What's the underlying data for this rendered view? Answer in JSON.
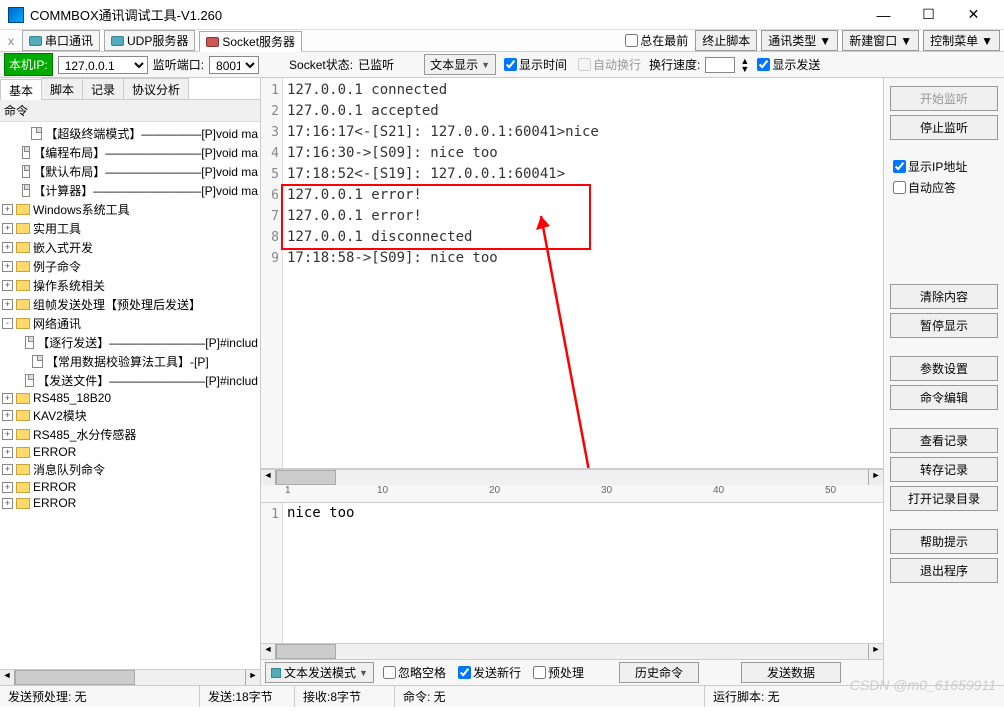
{
  "title": "COMMBOX通讯调试工具-V1.260",
  "topbar": {
    "tabs": [
      {
        "label": "串口通讯",
        "close": "x"
      },
      {
        "label": "UDP服务器",
        "close": "x"
      },
      {
        "label": "Socket服务器",
        "close": "x"
      }
    ],
    "always_top": "总在最前",
    "stop_script": "终止脚本",
    "comm_type": "通讯类型",
    "new_window": "新建窗口",
    "ctrl_menu": "控制菜单"
  },
  "toolbar": {
    "ip_label": "本机IP:",
    "ip_value": "127.0.0.1",
    "listen_port_label": "监听端口:",
    "port_value": "8001",
    "socket_status_label": "Socket状态:",
    "socket_status_value": "已监听",
    "text_display": "文本显示",
    "show_time": "显示时间",
    "auto_wrap": "自动换行",
    "wrap_speed": "换行速度:",
    "show_send": "显示发送"
  },
  "sidebar": {
    "tabs": [
      "基本",
      "脚本",
      "记录",
      "协议分析"
    ],
    "header": "命令",
    "items": [
      {
        "indent": 1,
        "exp": "",
        "icon": "file",
        "label": "【超级终端模式】—————[P]void ma"
      },
      {
        "indent": 1,
        "exp": "",
        "icon": "file",
        "label": "【编程布局】————————[P]void ma"
      },
      {
        "indent": 1,
        "exp": "",
        "icon": "file",
        "label": "【默认布局】————————[P]void ma"
      },
      {
        "indent": 1,
        "exp": "",
        "icon": "file",
        "label": "【计算器】—————————[P]void ma"
      },
      {
        "indent": 0,
        "exp": "+",
        "icon": "folder",
        "label": "Windows系统工具"
      },
      {
        "indent": 0,
        "exp": "+",
        "icon": "folder",
        "label": "实用工具"
      },
      {
        "indent": 0,
        "exp": "+",
        "icon": "folder",
        "label": "嵌入式开发"
      },
      {
        "indent": 0,
        "exp": "+",
        "icon": "folder",
        "label": "例子命令"
      },
      {
        "indent": 0,
        "exp": "+",
        "icon": "folder",
        "label": "操作系统相关"
      },
      {
        "indent": 0,
        "exp": "+",
        "icon": "folder",
        "label": "组帧发送处理【预处理后发送】"
      },
      {
        "indent": 0,
        "exp": "-",
        "icon": "folder",
        "label": "网络通讯"
      },
      {
        "indent": 1,
        "exp": "",
        "icon": "file",
        "label": "【逐行发送】————————[P]#includ"
      },
      {
        "indent": 1,
        "exp": "",
        "icon": "file",
        "label": "【常用数据校验算法工具】-[P]"
      },
      {
        "indent": 1,
        "exp": "",
        "icon": "file",
        "label": "【发送文件】————————[P]#includ"
      },
      {
        "indent": 0,
        "exp": "+",
        "icon": "folder",
        "label": "RS485_18B20"
      },
      {
        "indent": 0,
        "exp": "+",
        "icon": "folder",
        "label": "KAV2模块"
      },
      {
        "indent": 0,
        "exp": "+",
        "icon": "folder",
        "label": "RS485_水分传感器"
      },
      {
        "indent": 0,
        "exp": "+",
        "icon": "folder",
        "label": "ERROR"
      },
      {
        "indent": 0,
        "exp": "+",
        "icon": "folder",
        "label": "消息队列命令"
      },
      {
        "indent": 0,
        "exp": "+",
        "icon": "folder",
        "label": "ERROR"
      },
      {
        "indent": 0,
        "exp": "+",
        "icon": "folder",
        "label": "ERROR"
      }
    ]
  },
  "log": {
    "lines": [
      "127.0.0.1 connected",
      "127.0.0.1 accepted",
      "17:16:17<-[S21]: 127.0.0.1:60041>nice",
      "17:16:30->[S09]: nice too",
      "17:18:52<-[S19]: 127.0.0.1:60041>",
      "127.0.0.1 error!",
      "127.0.0.1 error!",
      "127.0.0.1 disconnected",
      "17:18:58->[S09]: nice too"
    ]
  },
  "input": {
    "line1": "nice too"
  },
  "ruler": {
    "marks": [
      "1",
      "10",
      "20",
      "30",
      "40",
      "50"
    ]
  },
  "bottom": {
    "send_mode": "文本发送模式",
    "ignore_space": "忽略空格",
    "send_newline": "发送新行",
    "preprocess": "预处理",
    "history": "历史命令",
    "send_data": "发送数据"
  },
  "right": {
    "start_listen": "开始监听",
    "stop_listen": "停止监听",
    "show_ip": "显示IP地址",
    "auto_reply": "自动应答",
    "clear": "清除内容",
    "pause": "暂停显示",
    "params": "参数设置",
    "cmd_edit": "命令编辑",
    "view_log": "查看记录",
    "save_log": "转存记录",
    "open_log_dir": "打开记录目录",
    "help": "帮助提示",
    "exit": "退出程序"
  },
  "status": {
    "send_pre": "发送预处理:  无",
    "sent": "发送:18字节",
    "recv": "接收:8字节",
    "cmd": "命令:  无",
    "script": "运行脚本:  无"
  },
  "watermark": "CSDN @m0_61659911"
}
